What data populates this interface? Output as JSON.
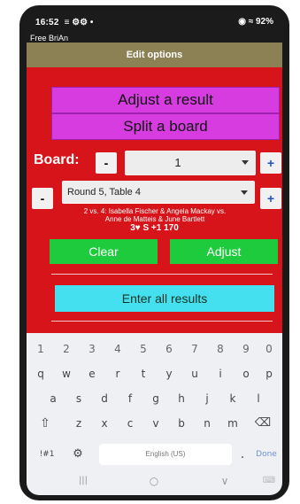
{
  "status": {
    "time": "16:52",
    "icons_left": "≡ ⚙⚙ •",
    "icons_right": "◉ ≈ 92%"
  },
  "app": {
    "title": "Free BriAn"
  },
  "header": {
    "title": "Edit options"
  },
  "buttons": {
    "adjust_result": "Adjust a result",
    "split_board": "Split a board",
    "clear": "Clear",
    "adjust": "Adjust",
    "enter_all": "Enter all results"
  },
  "board": {
    "label": "Board:",
    "minus": "-",
    "plus": "+",
    "value": "1"
  },
  "round": {
    "minus": "-",
    "plus": "+",
    "value": "Round 5, Table 4"
  },
  "match": {
    "line1": "2 vs. 4: Isabella Fischer & Angela Mackay vs.",
    "line2": "Anne de Matteis & June Bartlett"
  },
  "contract": {
    "text": "3♥ S +1  170"
  },
  "keyboard": {
    "numbers": [
      "1",
      "2",
      "3",
      "4",
      "5",
      "6",
      "7",
      "8",
      "9",
      "0"
    ],
    "row1": [
      "q",
      "w",
      "e",
      "r",
      "t",
      "y",
      "u",
      "i",
      "o",
      "p"
    ],
    "row2": [
      "a",
      "s",
      "d",
      "f",
      "g",
      "h",
      "j",
      "k",
      "l"
    ],
    "row3": [
      "z",
      "x",
      "c",
      "v",
      "b",
      "n",
      "m"
    ],
    "shift": "⇧",
    "backspace": "⌫",
    "symbols": "!#1",
    "settings": "⚙",
    "space": "English (US)",
    "period": ".",
    "done": "Done"
  },
  "nav": {
    "recents": "|||",
    "home": "○",
    "back": "∨",
    "keyboard_icon": "⌨"
  }
}
